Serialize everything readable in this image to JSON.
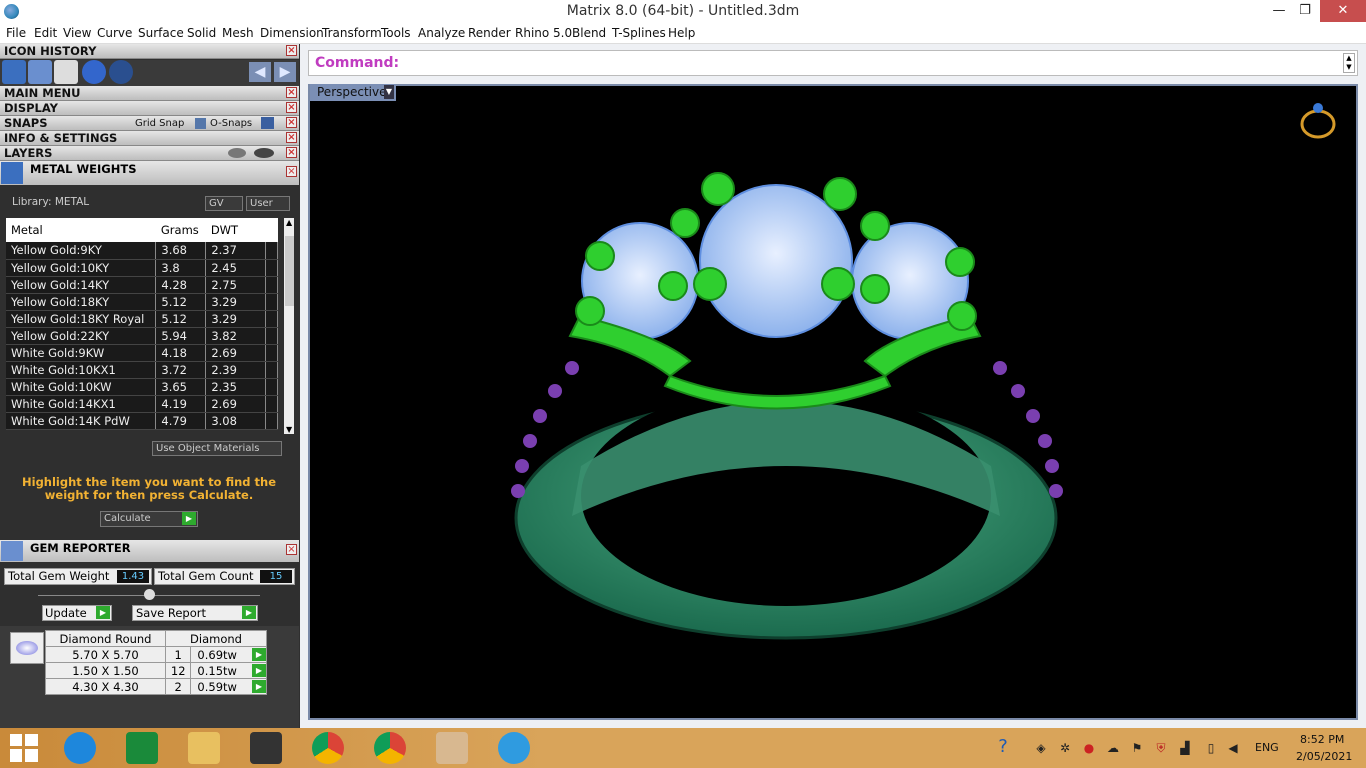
{
  "window": {
    "title": "Matrix 8.0 (64-bit) - Untitled.3dm",
    "minimize": "—",
    "maximize": "❐",
    "close": "✕"
  },
  "menu": [
    "File",
    "Edit",
    "View",
    "Curve",
    "Surface",
    "Solid",
    "Mesh",
    "Dimension",
    "Transform",
    "Tools",
    "Analyze",
    "Render",
    "Rhino 5.0",
    "Blend",
    "T-Splines",
    "Help"
  ],
  "panels": {
    "icon_history": "ICON HISTORY",
    "main_menu": "MAIN MENU",
    "display": "DISPLAY",
    "snaps": "SNAPS",
    "grid_snap": "Grid Snap",
    "o_snaps": "O-Snaps",
    "info_settings": "INFO & SETTINGS",
    "layers": "LAYERS",
    "metal_weights": "METAL WEIGHTS",
    "gem_reporter": "GEM REPORTER"
  },
  "metal": {
    "library": "Library: METAL",
    "gv": "GV",
    "user": "User",
    "headers": [
      "Metal",
      "Grams",
      "DWT"
    ],
    "rows": [
      [
        "Yellow Gold:9KY",
        "3.68",
        "2.37"
      ],
      [
        "Yellow Gold:10KY",
        "3.8",
        "2.45"
      ],
      [
        "Yellow Gold:14KY",
        "4.28",
        "2.75"
      ],
      [
        "Yellow Gold:18KY",
        "5.12",
        "3.29"
      ],
      [
        "Yellow Gold:18KY Royal",
        "5.12",
        "3.29"
      ],
      [
        "Yellow Gold:22KY",
        "5.94",
        "3.82"
      ],
      [
        "White Gold:9KW",
        "4.18",
        "2.69"
      ],
      [
        "White Gold:10KX1",
        "3.72",
        "2.39"
      ],
      [
        "White Gold:10KW",
        "3.65",
        "2.35"
      ],
      [
        "White Gold:14KX1",
        "4.19",
        "2.69"
      ],
      [
        "White Gold:14K PdW",
        "4.79",
        "3.08"
      ]
    ],
    "use_object_materials": "Use Object Materials",
    "instructions": "Highlight the item you want to find the weight for then press Calculate.",
    "calculate": "Calculate"
  },
  "gem": {
    "total_weight_label": "Total Gem Weight",
    "total_weight": "1.43",
    "total_count_label": "Total Gem Count",
    "total_count": "15",
    "update": "Update",
    "save_report": "Save Report",
    "headers": [
      "Diamond Round",
      "Diamond"
    ],
    "rows": [
      [
        "5.70 X 5.70",
        "1",
        "0.69tw"
      ],
      [
        "1.50 X 1.50",
        "12",
        "0.15tw"
      ],
      [
        "4.30 X 4.30",
        "2",
        "0.59tw"
      ]
    ]
  },
  "command": {
    "label": "Command:"
  },
  "viewport": {
    "name": "Perspective"
  },
  "taskbar": {
    "lang": "ENG",
    "time": "8:52 PM",
    "date": "2/05/2021"
  }
}
